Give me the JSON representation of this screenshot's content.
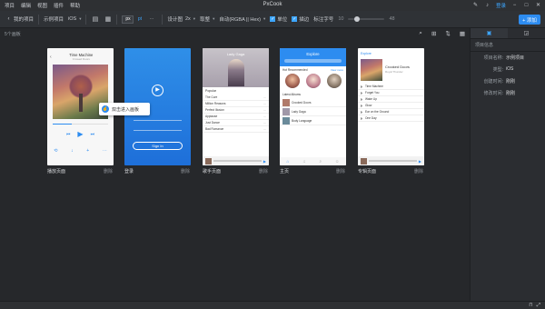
{
  "app": {
    "title": "PxCook",
    "menu": [
      "项目",
      "编辑",
      "视图",
      "插件",
      "帮助"
    ],
    "login": "登录"
  },
  "toolbar": {
    "my_projects": "我的项目",
    "project": "示例项目",
    "platform": "iOS",
    "unit_px": "px",
    "unit_pt": "pt",
    "design_label": "设计图",
    "design_scale": "2x",
    "color_mode": "取整",
    "color_format": "自动(RGBA || Hex)",
    "unit_check": "单位",
    "stroke_check": "描边",
    "font_label": "标注字号",
    "font_min": "10",
    "font_max": "48",
    "slider_level": 0.18,
    "add_button": "+ 添加"
  },
  "subbar": {
    "count": "5个画板"
  },
  "boards": [
    {
      "label": "播放页面",
      "size": "删除"
    },
    {
      "label": "登录",
      "size": "删除"
    },
    {
      "label": "歌手页面",
      "size": "删除"
    },
    {
      "label": "主页",
      "size": "删除"
    },
    {
      "label": "专辑页面",
      "size": "删除"
    }
  ],
  "phones": {
    "player": {
      "title": "Time Machine",
      "artist": "Crowed Doors"
    },
    "login": {
      "button": "Sign In"
    },
    "singer": {
      "title": "Lady Gaga",
      "section": "Popular",
      "songs": [
        "The Cure",
        "Million Reasons",
        "Perfect Illusion",
        "Applause",
        "Just Dance",
        "Bad Romance"
      ]
    },
    "home": {
      "title": "Explore",
      "section1": "Hot Recommended",
      "more": "View more",
      "section2": "Latest Albums",
      "albums": [
        "Crooked Doors",
        "Lady Gaga",
        "Body Language"
      ]
    },
    "album": {
      "back": "Explore",
      "title": "Crooked Doors",
      "artist": "Royal Thunder",
      "songs": [
        "Time Machine",
        "Forget You",
        "Wake Up",
        "Glow",
        "Ear on the Ground",
        "One Day"
      ]
    }
  },
  "tooltip": {
    "text": "双击进入画板"
  },
  "side": {
    "tabs": [
      "▣",
      "◲"
    ],
    "header": "项目信息",
    "props": [
      {
        "k": "项目名称:",
        "v": "示例项目"
      },
      {
        "k": "类型:",
        "v": "iOS"
      },
      {
        "k": "创建时间:",
        "v": "刚刚"
      },
      {
        "k": "修改时间:",
        "v": "刚刚"
      }
    ]
  },
  "colors": {
    "accent": "#2d8cf0",
    "bg": "#26282b",
    "panel": "#2b2d31"
  }
}
